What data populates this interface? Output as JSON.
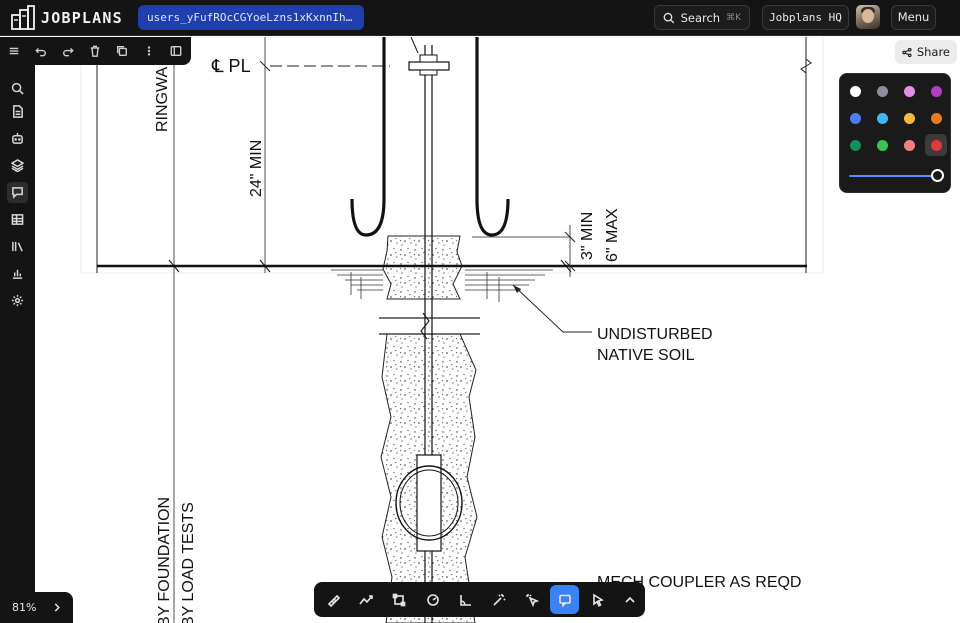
{
  "app": {
    "name": "JOBPLANS",
    "project": "users_yFufROcCGYoeLzns1xKxnnIhS…"
  },
  "header": {
    "search_label": "Search",
    "search_shortcut": "⌘K",
    "org_label": "Jobplans HQ",
    "menu_label": "Menu"
  },
  "share_label": "Share",
  "zoom_label": "81%",
  "drawing": {
    "labels": {
      "centerline": "℄ PL",
      "ringwall": "RINGWA",
      "min24": "24\" MIN",
      "min3": "3\" MIN",
      "max6": "6\" MAX",
      "soil1": "UNDISTURBED",
      "soil2": "NATIVE SOIL",
      "coupler": "MECH COUPLER AS REQD",
      "foundation": "BY FOUNDATION",
      "loadtests": "BY LOAD TESTS"
    }
  },
  "colors": {
    "accent": "#3b82f6",
    "project_pill": "#1f3fae",
    "swatches": [
      "#ffffff",
      "#8a8f99",
      "#e58ee8",
      "#b43cc9",
      "#4f7df5",
      "#3eb8f5",
      "#f6b93b",
      "#f07a1a",
      "#11905a",
      "#3fbf57",
      "#f08080",
      "#e53935"
    ],
    "selected_swatch": "#e53935"
  },
  "stroke_width_level": 1.0,
  "sidebar_icons": [
    "menu-icon",
    "search-icon",
    "document-icon",
    "robot-icon",
    "layers-icon",
    "comment-icon",
    "table-icon",
    "library-icon",
    "chart-icon",
    "settings-icon"
  ],
  "edit_toolbar_icons": [
    "undo-icon",
    "redo-icon",
    "trash-icon",
    "duplicate-icon",
    "more-icon",
    "panel-icon"
  ],
  "tools": [
    "ruler-icon",
    "polyline-icon",
    "rectangle-icon",
    "circle-icon",
    "angle-icon",
    "magic-wand-icon",
    "smart-select-icon",
    "comment-box-icon",
    "pointer-icon",
    "chevron-up-icon"
  ],
  "active_tool": "comment-box-icon"
}
